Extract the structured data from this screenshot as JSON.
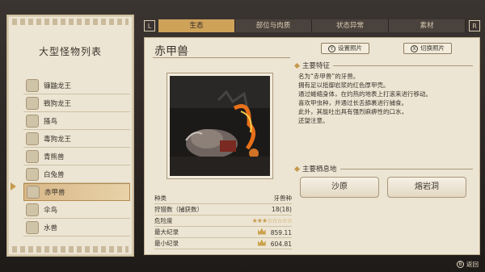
{
  "left_panel": {
    "title": "大型怪物列表",
    "items": [
      {
        "label": "镰鼬龙王"
      },
      {
        "label": "戦狗龙王"
      },
      {
        "label": "搔鸟"
      },
      {
        "label": "毒狗龙王"
      },
      {
        "label": "青熊兽"
      },
      {
        "label": "白兔兽"
      },
      {
        "label": "赤甲兽",
        "selected": true
      },
      {
        "label": "伞鸟"
      },
      {
        "label": "水兽"
      }
    ]
  },
  "tabs": {
    "left_bracket": "L",
    "right_bracket": "R",
    "items": [
      {
        "label": "生态",
        "active": true
      },
      {
        "label": "部位与肉质"
      },
      {
        "label": "状态异常"
      },
      {
        "label": "素材"
      }
    ]
  },
  "main": {
    "monster_name": "赤甲兽",
    "set_photo": {
      "key": "Y",
      "label": "设置照片"
    },
    "switch_photo": {
      "key": "X",
      "label": "切换照片"
    },
    "features_title": "主要特征",
    "description": [
      "名为“赤甲兽”的牙兽。",
      "拥有足以抵御岩浆的红色厚甲壳。",
      "通过蜷缩身体，在灼热的地表上打滚来进行移动。",
      "喜欢甲虫种，并通过长舌舔裹进行捕食。",
      "此外，其能吐出具有强烈麻痹性的口水，",
      "还望注意。"
    ],
    "habitat_title": "主要栖息地",
    "habitats": [
      "沙原",
      "熔岩洞"
    ],
    "stats": {
      "type_label": "种类",
      "type_value": "牙兽种",
      "hunted_label": "狩猎数（捕获数）",
      "hunted_value": "18(18)",
      "danger_label": "危险度",
      "danger_stars": 3,
      "danger_max": 8,
      "max_label": "最大纪录",
      "max_value": "859.11",
      "min_label": "最小纪录",
      "min_value": "604.81"
    }
  },
  "footer": {
    "back_key": "B",
    "back_label": "返回"
  }
}
